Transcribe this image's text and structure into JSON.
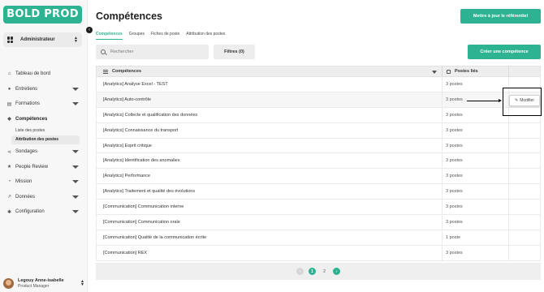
{
  "app": {
    "logo": "BOLD PROD"
  },
  "sidebar": {
    "role": "Administrateur",
    "items": [
      {
        "label": "Tableau de bord",
        "icon": "home-icon",
        "has_chevron": false
      },
      {
        "label": "Entretiens",
        "icon": "chat-icon",
        "has_chevron": true
      },
      {
        "label": "Formations",
        "icon": "book-icon",
        "has_chevron": true
      },
      {
        "label": "Compétences",
        "icon": "skills-icon",
        "has_chevron": false,
        "active": true
      },
      {
        "label": "Sondages",
        "icon": "share-icon",
        "has_chevron": true
      },
      {
        "label": "People Review",
        "icon": "star-icon",
        "has_chevron": true
      },
      {
        "label": "Mission",
        "icon": "pie-icon",
        "has_chevron": true
      },
      {
        "label": "Données",
        "icon": "chart-icon",
        "has_chevron": true
      },
      {
        "label": "Configuration",
        "icon": "gear-icon",
        "has_chevron": true
      }
    ],
    "subitems": [
      {
        "label": "Liste des postes"
      },
      {
        "label": "Attribution des postes",
        "active": true
      }
    ],
    "user": {
      "name": "Legouy Anne-isabelle",
      "role": "Product Manager"
    }
  },
  "page": {
    "title": "Compétences",
    "update_button": "Mettre à jour le référentiel",
    "create_button": "Créer une compétence",
    "tabs": [
      {
        "label": "Compétences",
        "active": true
      },
      {
        "label": "Groupes"
      },
      {
        "label": "Fiches de poste"
      },
      {
        "label": "Attribution des postes"
      }
    ],
    "search_placeholder": "Rechercher",
    "filters_button": "Filtres (0)"
  },
  "table": {
    "col1": "Compétences",
    "col2": "Postes liés",
    "rows": [
      {
        "name": "[Analytics] Analyse Excel - TEST",
        "posts": "3 postes"
      },
      {
        "name": "[Analytics] Auto-contrôle",
        "posts": "3 postes"
      },
      {
        "name": "[Analytics] Collecte et qualification des données",
        "posts": "3 postes"
      },
      {
        "name": "[Analytics] Connaissance du transport",
        "posts": "3 postes"
      },
      {
        "name": "[Analytics] Esprit critique",
        "posts": "3 postes"
      },
      {
        "name": "[Analytics] Identification des anomalies",
        "posts": "3 postes"
      },
      {
        "name": "[Analytics] Performance",
        "posts": "3 postes"
      },
      {
        "name": "[Analytics] Traitement et qualité des évolutions",
        "posts": "3 postes"
      },
      {
        "name": "[Communication] Communication interne",
        "posts": "3 postes"
      },
      {
        "name": "[Communication] Communication orale",
        "posts": "3 postes"
      },
      {
        "name": "[Communication] Qualité de la communication écrite",
        "posts": "1 poste"
      },
      {
        "name": "[Communication] REX",
        "posts": "3 postes"
      }
    ],
    "modify_button": "Modifier"
  },
  "pagination": {
    "pages": [
      "1",
      "2"
    ],
    "current": "1"
  },
  "colors": {
    "accent": "#2eb392"
  }
}
